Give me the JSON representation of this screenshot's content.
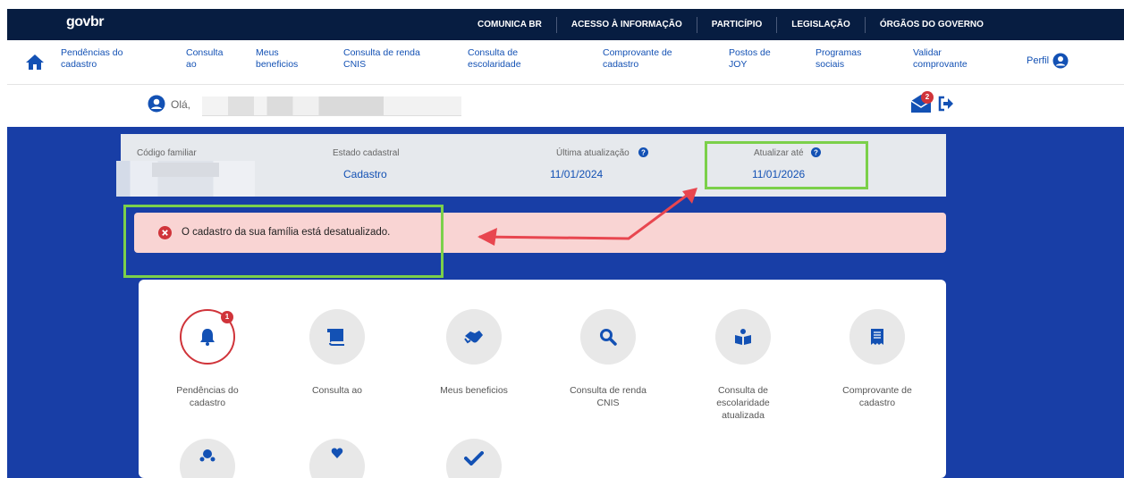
{
  "header": {
    "logo": "govbr",
    "links": [
      "COMUNICA BR",
      "ACESSO À INFORMAÇÃO",
      "PARTICÍPIO",
      "LEGISLAÇÃO",
      "ÓRGÃOS DO GOVERNO"
    ]
  },
  "nav": {
    "items": [
      {
        "l1": "Pendências do",
        "l2": "cadastro"
      },
      {
        "l1": "Consulta",
        "l2": "ao"
      },
      {
        "l1": "Meus",
        "l2": "beneficios"
      },
      {
        "l1": "Consulta de renda",
        "l2": "CNIS"
      },
      {
        "l1": "Consulta de",
        "l2": "escolaridade"
      },
      {
        "l1": "Comprovante de",
        "l2": "cadastro"
      },
      {
        "l1": "Postos de",
        "l2": "JOY"
      },
      {
        "l1": "Programas",
        "l2": "sociais"
      },
      {
        "l1": "Validar",
        "l2": "comprovante"
      }
    ],
    "perfil": "Perfil"
  },
  "user": {
    "greeting": "Olá,",
    "mail_badge": "2"
  },
  "info": {
    "codigo_label": "Código familiar",
    "estado_label": "Estado cadastral",
    "estado_value": "Cadastro",
    "ultima_label": "Última atualização",
    "ultima_value": "11/01/2024",
    "atualizar_label": "Atualizar até",
    "atualizar_value": "11/01/2026"
  },
  "alert": {
    "text": "O cadastro da sua família está desatualizado."
  },
  "services": [
    {
      "l1": "Pendências do",
      "l2": "cadastro",
      "l3": "",
      "icon": "bell-icon",
      "badge": "1"
    },
    {
      "l1": "Consulta ao",
      "l2": "",
      "l3": "",
      "icon": "book-icon",
      "badge": ""
    },
    {
      "l1": "Meus beneficios",
      "l2": "",
      "l3": "",
      "icon": "handshake-icon",
      "badge": ""
    },
    {
      "l1": "Consulta de renda",
      "l2": "CNIS",
      "l3": "",
      "icon": "search-icon",
      "badge": ""
    },
    {
      "l1": "Consulta de",
      "l2": "escolaridade",
      "l3": "atualizada",
      "icon": "reading-icon",
      "badge": ""
    },
    {
      "l1": "Comprovante de",
      "l2": "cadastro",
      "l3": "",
      "icon": "receipt-icon",
      "badge": ""
    }
  ],
  "colors": {
    "header_bg": "#071d41",
    "primary_blue": "#1351b4",
    "page_blue": "#183ea6",
    "alert_bg": "#f9d4d3",
    "highlight_green": "#7bd04a",
    "arrow_red": "#e8464f"
  }
}
